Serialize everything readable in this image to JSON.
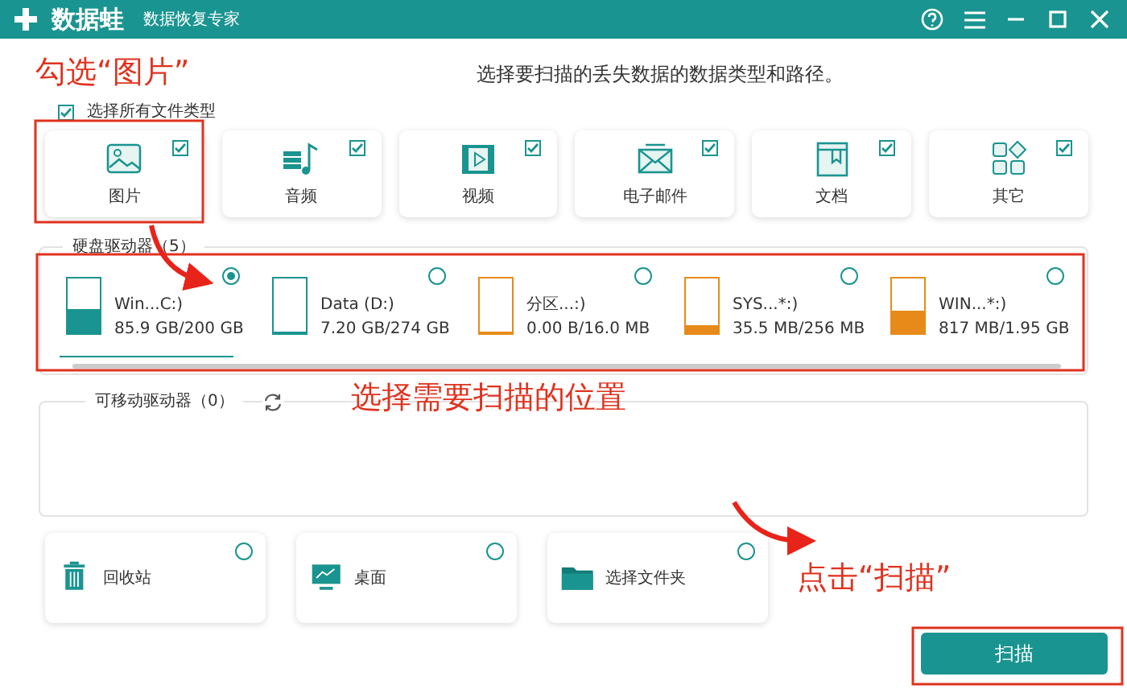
{
  "window": {
    "app_name": "数据蛙",
    "subtitle": "数据恢复专家"
  },
  "instruction": "选择要扫描的丢失数据的数据类型和路径。",
  "select_all": {
    "label": "选择所有文件类型",
    "checked": true
  },
  "file_types": [
    {
      "kind": "image",
      "label": "图片",
      "checked": true
    },
    {
      "kind": "audio",
      "label": "音频",
      "checked": true
    },
    {
      "kind": "video",
      "label": "视频",
      "checked": true
    },
    {
      "kind": "email",
      "label": "电子邮件",
      "checked": true
    },
    {
      "kind": "document",
      "label": "文档",
      "checked": true
    },
    {
      "kind": "other",
      "label": "其它",
      "checked": true
    }
  ],
  "hard_drives": {
    "label": "硬盘驱动器（5）",
    "drives": [
      {
        "name": "Win...C:)",
        "usage": "85.9 GB/200 GB",
        "level": 0.43,
        "color": "#1a9490",
        "selected": true
      },
      {
        "name": "Data (D:)",
        "usage": "7.20 GB/274 GB",
        "level": 0.03,
        "color": "#1a9490",
        "selected": false
      },
      {
        "name": "分区...:)",
        "usage": "0.00  B/16.0 MB",
        "level": 0,
        "color": "#e88a1a",
        "selected": false
      },
      {
        "name": "SYS...*:)",
        "usage": "35.5 MB/256 MB",
        "level": 0.14,
        "color": "#e88a1a",
        "selected": false
      },
      {
        "name": "WIN...*:)",
        "usage": "817 MB/1.95 GB",
        "level": 0.42,
        "color": "#e88a1a",
        "selected": false
      }
    ]
  },
  "removable_drives": {
    "label": "可移动驱动器（0）"
  },
  "locations": [
    {
      "kind": "recycle",
      "label": "回收站",
      "selected": false
    },
    {
      "kind": "desktop",
      "label": "桌面",
      "selected": false
    },
    {
      "kind": "folder",
      "label": "选择文件夹",
      "selected": false
    }
  ],
  "scan_button": "扫描",
  "annotations": [
    "勾选“图片”",
    "选择需要扫描的位置",
    "点击“扫描”"
  ]
}
